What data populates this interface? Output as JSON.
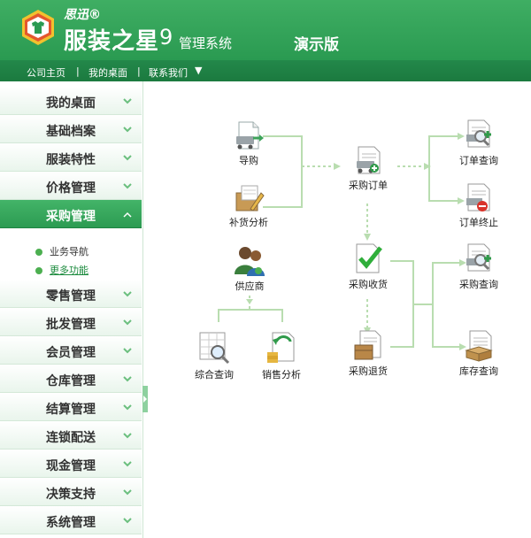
{
  "header": {
    "brand_small": "思迅®",
    "brand_big": "服装之星",
    "version": "9",
    "system": "管理系统",
    "demo": "演示版"
  },
  "navbar": {
    "home": "公司主页",
    "desktop": "我的桌面",
    "contact": "联系我们",
    "sep": "|",
    "dropdown": "▼"
  },
  "sidebar": {
    "items": [
      {
        "label": "我的桌面"
      },
      {
        "label": "基础档案"
      },
      {
        "label": "服装特性"
      },
      {
        "label": "价格管理"
      },
      {
        "label": "采购管理"
      },
      {
        "label": "零售管理"
      },
      {
        "label": "批发管理"
      },
      {
        "label": "会员管理"
      },
      {
        "label": "仓库管理"
      },
      {
        "label": "结算管理"
      },
      {
        "label": "连锁配送"
      },
      {
        "label": "现金管理"
      },
      {
        "label": "决策支持"
      },
      {
        "label": "系统管理"
      }
    ],
    "sub_items": [
      {
        "label": "业务导航"
      },
      {
        "label": "更多功能"
      }
    ]
  },
  "flow": {
    "guide": "导购",
    "restock": "补货分析",
    "supplier": "供应商",
    "summary_query": "综合查询",
    "sales_analysis": "销售分析",
    "purchase_order": "采购订单",
    "purchase_receive": "采购收货",
    "purchase_return": "采购退货",
    "order_query": "订单查询",
    "order_terminate": "订单终止",
    "purchase_query": "采购查询",
    "stock_query": "库存查询"
  },
  "colors": {
    "brand_green": "#2a9a51",
    "flow_line": "#b9ddb0"
  }
}
